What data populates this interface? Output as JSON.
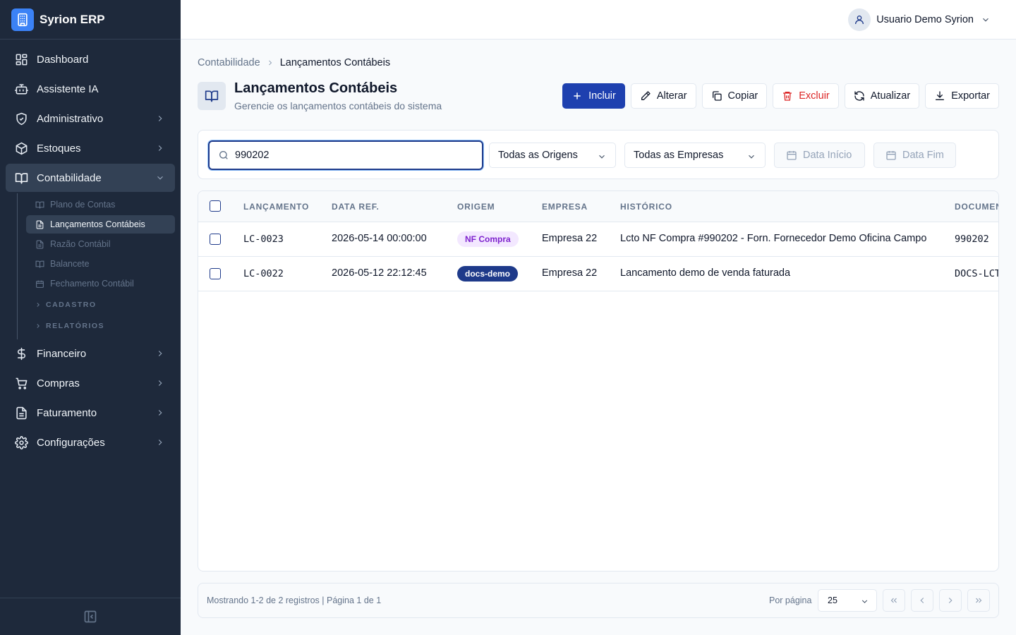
{
  "app": {
    "name": "Syrion ERP"
  },
  "colors": {
    "sidebar_bg": "#1e293b",
    "primary": "#1e40af",
    "danger": "#dc2626",
    "badge_nf_bg": "#f3e8ff",
    "badge_nf_text": "#7e22ce",
    "badge_docs_bg": "#1e3a8a"
  },
  "sidebar": {
    "items": [
      {
        "label": "Dashboard",
        "icon": "dashboard-icon"
      },
      {
        "label": "Assistente IA",
        "icon": "bot-icon"
      },
      {
        "label": "Administrativo",
        "icon": "shield-icon"
      },
      {
        "label": "Estoques",
        "icon": "package-icon"
      },
      {
        "label": "Contabilidade",
        "icon": "book-icon"
      },
      {
        "label": "Financeiro",
        "icon": "dollar-icon"
      },
      {
        "label": "Compras",
        "icon": "cart-icon"
      },
      {
        "label": "Faturamento",
        "icon": "invoice-icon"
      },
      {
        "label": "Configurações",
        "icon": "gear-icon"
      }
    ],
    "contabilidade_sub": [
      {
        "label": "Plano de Contas",
        "icon": "book-open-icon"
      },
      {
        "label": "Lançamentos Contábeis",
        "icon": "document-icon"
      },
      {
        "label": "Razão Contábil",
        "icon": "document-icon"
      },
      {
        "label": "Balancete",
        "icon": "book-open-icon"
      },
      {
        "label": "Fechamento Contábil",
        "icon": "calendar-icon"
      }
    ],
    "groups": [
      {
        "label": "CADASTRO"
      },
      {
        "label": "RELATÓRIOS"
      }
    ]
  },
  "header": {
    "user_name": "Usuario Demo Syrion"
  },
  "breadcrumb": {
    "parent": "Contabilidade",
    "current": "Lançamentos Contábeis"
  },
  "page": {
    "title": "Lançamentos Contábeis",
    "subtitle": "Gerencie os lançamentos contábeis do sistema"
  },
  "toolbar": {
    "incluir": "Incluir",
    "alterar": "Alterar",
    "copiar": "Copiar",
    "excluir": "Excluir",
    "atualizar": "Atualizar",
    "exportar": "Exportar"
  },
  "filters": {
    "search_value": "990202",
    "origem": "Todas as Origens",
    "empresa": "Todas as Empresas",
    "data_inicio": "Data Início",
    "data_fim": "Data Fim"
  },
  "table": {
    "columns": [
      "LANÇAMENTO",
      "DATA REF.",
      "ORIGEM",
      "EMPRESA",
      "HISTÓRICO",
      "DOCUMENTO"
    ],
    "rows": [
      {
        "lancamento": "LC-0023",
        "data_ref": "2026-05-14 00:00:00",
        "origem": "NF Compra",
        "empresa": "Empresa 22",
        "historico": "Lcto NF Compra #990202 - Forn. Fornecedor Demo Oficina Campo",
        "documento": "990202"
      },
      {
        "lancamento": "LC-0022",
        "data_ref": "2026-05-12 22:12:45",
        "origem": "docs-demo",
        "empresa": "Empresa 22",
        "historico": "Lancamento demo de venda faturada",
        "documento": "DOCS-LCT"
      }
    ]
  },
  "pager": {
    "info": "Mostrando 1-2 de 2 registros | Página 1 de 1",
    "per_page_label": "Por página",
    "per_page": "25"
  }
}
